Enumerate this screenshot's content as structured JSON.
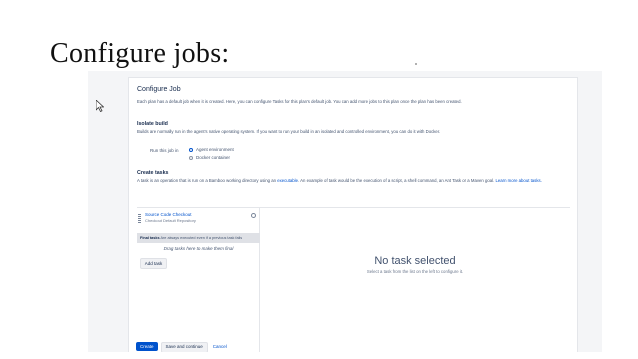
{
  "slide": {
    "title": "Configure jobs:"
  },
  "page": {
    "heading": "Configure Job",
    "intro": "Each plan has a default job when it is created. Here, you can configure Tasks for this plan's default job. You can add more jobs to this plan once the plan has been created.",
    "isolate": {
      "heading": "Isolate build",
      "desc": "Builds are normally run in the agent's native operating system. If you want to run your build in an isolated and controlled environment, you can do it with Docker.",
      "run_label": "Run this job in",
      "options": [
        "Agent environment",
        "Docker container"
      ],
      "selected": "Agent environment"
    },
    "tasks": {
      "heading": "Create tasks",
      "desc_before": "A task is an operation that is run on a Bamboo working directory using an",
      "desc_link": "executable",
      "desc_after": ". An example of task would be the execution of a script, a shell command, an Ant Task or a Maven goal.",
      "learn_more": "Learn more about tasks."
    },
    "task_list": {
      "item_name": "Source Code Checkout",
      "item_sub": "Checkout Default Repository",
      "final_label": "Final tasks",
      "final_desc": "Are always executed even if a previous task fails",
      "drag_hint": "Drag tasks here to make them final",
      "add_task": "Add task"
    },
    "empty_state": {
      "title": "No task selected",
      "subtitle": "Select a task from the list on the left to configure it."
    },
    "footer": {
      "create": "Create",
      "save_continue": "Save and continue",
      "cancel": "Cancel"
    }
  },
  "colors": {
    "primary": "#0052cc",
    "text": "#172b4d"
  }
}
